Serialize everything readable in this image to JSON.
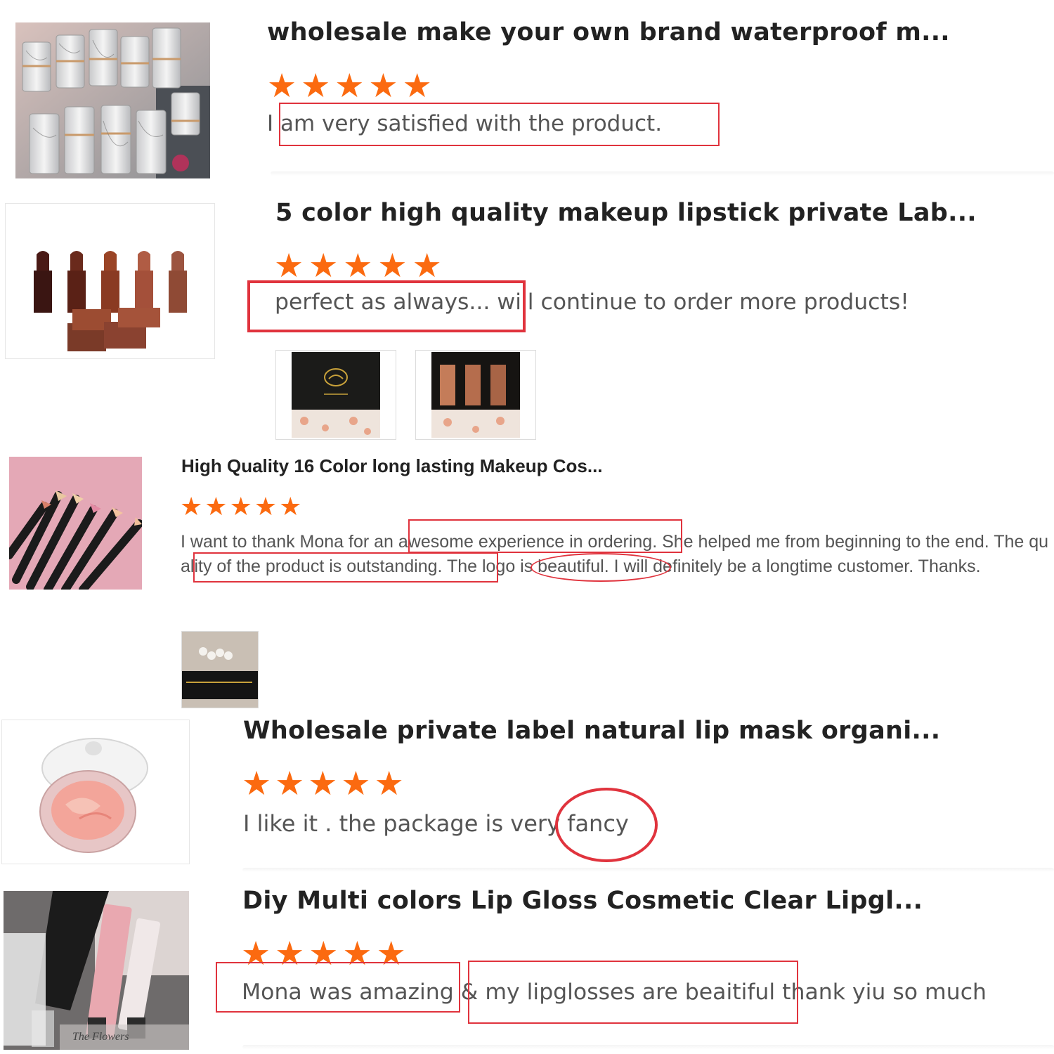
{
  "reviews": [
    {
      "title": "wholesale make your own brand waterproof m...",
      "stars": [
        "★",
        "★",
        "★",
        "★",
        "★"
      ],
      "text": "I am very satisfied with the product."
    },
    {
      "title": "5 color high quality makeup lipstick private Lab...",
      "stars": [
        "★",
        "★",
        "★",
        "★",
        "★"
      ],
      "text": "perfect as always... will continue to order more products!"
    },
    {
      "title": "High Quality 16 Color long lasting Makeup Cos...",
      "stars": [
        "★",
        "★",
        "★",
        "★",
        "★"
      ],
      "text": "I want to thank Mona for an awesome experience in ordering. She helped me from beginning to the end. The quality of the product is outstanding. The logo is beautiful. I will definitely be a longtime customer. Thanks."
    },
    {
      "title": "Wholesale private label natural lip mask organi...",
      "stars": [
        "★",
        "★",
        "★",
        "★",
        "★"
      ],
      "text": "I like it . the package is very fancy"
    },
    {
      "title": "Diy Multi colors Lip Gloss Cosmetic Clear Lipgl...",
      "stars": [
        "★",
        "★",
        "★",
        "★",
        "★"
      ],
      "text": "Mona was amazing & my lipglosses are beaitiful thank yiu so much"
    }
  ],
  "photo_text": {
    "lipgloss_caption": "The Flowers"
  },
  "colors": {
    "star": "#fb6a10",
    "highlight": "#e0333d"
  }
}
